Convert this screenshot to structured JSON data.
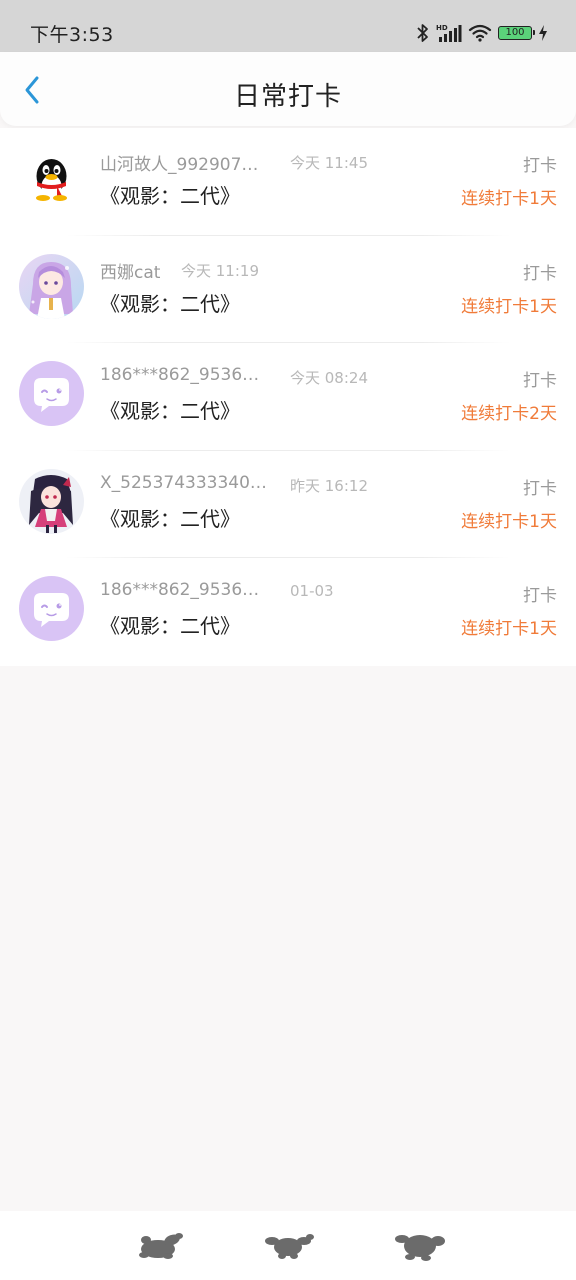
{
  "status_bar": {
    "time": "下午3:53",
    "battery": "100",
    "icons": [
      "bluetooth-icon",
      "hd-signal-icon",
      "wifi-icon",
      "battery-icon",
      "charging-icon"
    ]
  },
  "header": {
    "title": "日常打卡",
    "back_icon": "chevron-left-icon"
  },
  "colors": {
    "accent_blue": "#2b96d8",
    "streak_orange": "#f07b39",
    "avatar_purple": "#d9c4f5"
  },
  "checkins": [
    {
      "avatar": "qq-penguin-avatar",
      "name": "山河故人_992907…",
      "time": "今天 11:45",
      "title": "《观影：二代》",
      "action": "打卡",
      "streak": "连续打卡1天"
    },
    {
      "avatar": "anime-girl-avatar",
      "name": "西娜cat",
      "time": "今天 11:19",
      "title": "《观影：二代》",
      "action": "打卡",
      "streak": "连续打卡1天"
    },
    {
      "avatar": "chat-bubble-avatar",
      "name": "186***862_9536…",
      "time": "今天 08:24",
      "title": "《观影：二代》",
      "action": "打卡",
      "streak": "连续打卡2天"
    },
    {
      "avatar": "anime-character-avatar",
      "name": "X_525374333340…",
      "time": "昨天 16:12",
      "title": "《观影：二代》",
      "action": "打卡",
      "streak": "连续打卡1天"
    },
    {
      "avatar": "chat-bubble-avatar",
      "name": "186***862_9536…",
      "time": "01-03",
      "title": "《观影：二代》",
      "action": "打卡",
      "streak": "连续打卡1天"
    }
  ],
  "bottom_bar": {
    "items": [
      "bottom-mascot-icon-1",
      "bottom-mascot-icon-2",
      "bottom-mascot-icon-3"
    ]
  }
}
